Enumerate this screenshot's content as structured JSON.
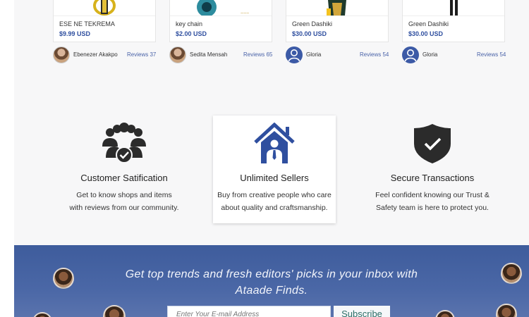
{
  "products": [
    {
      "name": "ESE NE TEKREMA",
      "price": "$9.99 USD"
    },
    {
      "name": "key chain",
      "price": "$2.00 USD"
    },
    {
      "name": "Green Dashiki",
      "price": "$30.00 USD"
    },
    {
      "name": "Green Dashiki",
      "price": "$30.00 USD"
    }
  ],
  "sellers": [
    {
      "name": "Ebenezer Akakpo",
      "reviews": "Reviews 37"
    },
    {
      "name": "Sedita Mensah",
      "reviews": "Reviews 65"
    },
    {
      "name": "Gloria",
      "reviews": "Reviews 54"
    },
    {
      "name": "Gloria",
      "reviews": "Reviews 54"
    }
  ],
  "features": [
    {
      "title": "Customer Satification",
      "line1": "Get to know shops and items",
      "line2": "with reviews from our community.",
      "icon": "community-icon"
    },
    {
      "title": "Unlimited Sellers",
      "line1": "Buy from creative people who care",
      "line2": "about quality and craftsmanship.",
      "icon": "house-seller-icon"
    },
    {
      "title": "Secure Transactions",
      "line1": "Feel confident knowing our Trust &",
      "line2": "Safety team is here to protect you.",
      "icon": "shield-check-icon"
    }
  ],
  "newsletter": {
    "headline_line1": "Get top trends and fresh editors' picks in your inbox with",
    "headline_line2": "Ataade Finds.",
    "email_placeholder": "Enter Your E-mail Address",
    "subscribe_label": "Subscribe"
  },
  "colors": {
    "accent_blue": "#2f4f9f",
    "newsletter_bg": "#4a67a6",
    "icon_dark": "#2b2b2b"
  }
}
